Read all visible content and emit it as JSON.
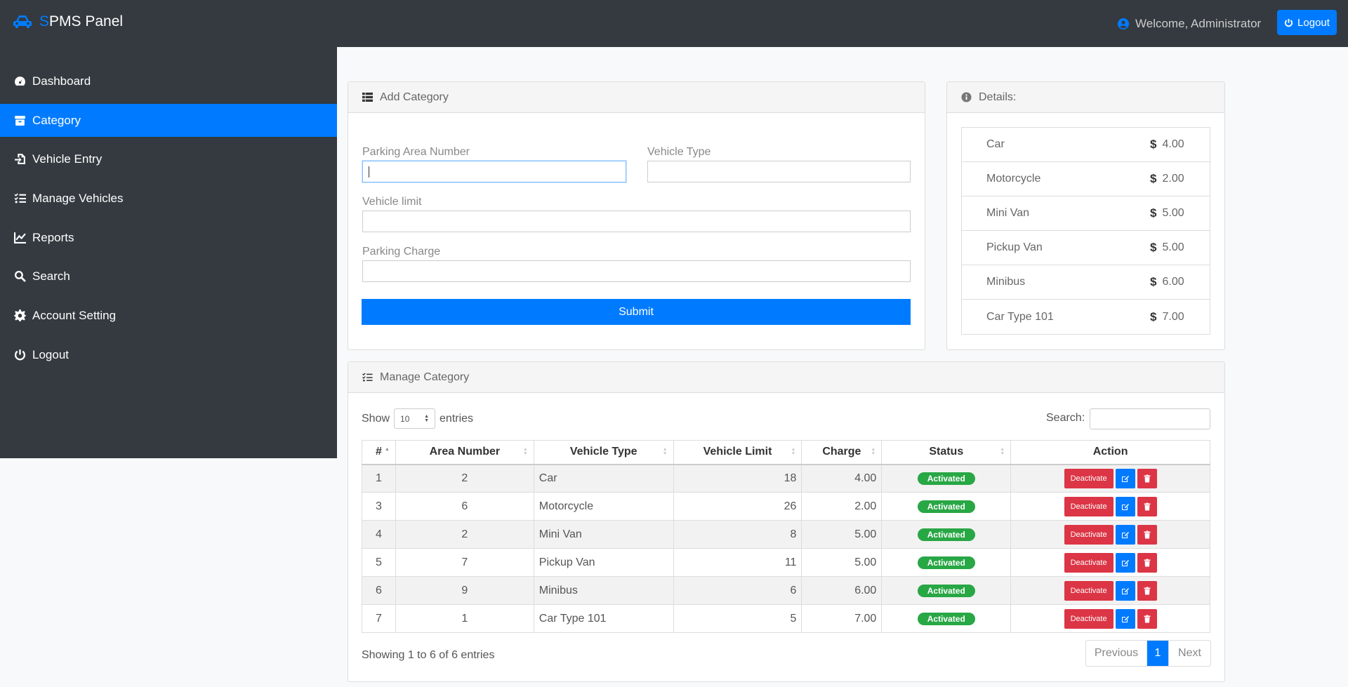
{
  "brand": {
    "first_letter": "S",
    "rest": "PMS Panel"
  },
  "header": {
    "welcome": "Welcome, Administrator",
    "logout_label": "Logout"
  },
  "sidebar": {
    "items": [
      {
        "label": "Dashboard",
        "icon": "tachometer-icon"
      },
      {
        "label": "Category",
        "icon": "box-icon",
        "active": true
      },
      {
        "label": "Vehicle Entry",
        "icon": "file-import-icon"
      },
      {
        "label": "Manage Vehicles",
        "icon": "tasks-icon"
      },
      {
        "label": "Reports",
        "icon": "line-chart-icon"
      },
      {
        "label": "Search",
        "icon": "search-icon"
      },
      {
        "label": "Account Setting",
        "icon": "gear-icon"
      },
      {
        "label": "Logout",
        "icon": "power-icon"
      }
    ]
  },
  "add_category": {
    "title": "Add Category",
    "parking_area_label": "Parking Area Number",
    "parking_area_value": "",
    "vehicle_type_label": "Vehicle Type",
    "vehicle_type_value": "",
    "vehicle_limit_label": "Vehicle limit",
    "vehicle_limit_value": "",
    "parking_charge_label": "Parking Charge",
    "parking_charge_value": "",
    "submit_label": "Submit"
  },
  "details": {
    "title": "Details:",
    "currency_symbol": "$",
    "items": [
      {
        "name": "Car",
        "price": "4.00"
      },
      {
        "name": "Motorcycle",
        "price": "2.00"
      },
      {
        "name": "Mini Van",
        "price": "5.00"
      },
      {
        "name": "Pickup Van",
        "price": "5.00"
      },
      {
        "name": "Minibus",
        "price": "6.00"
      },
      {
        "name": "Car Type 101",
        "price": "7.00"
      }
    ]
  },
  "manage_category": {
    "title": "Manage Category",
    "show_label": "Show",
    "entries_value": "10",
    "entries_label": "entries",
    "search_label": "Search:",
    "columns": [
      "#",
      "Area Number",
      "Vehicle Type",
      "Vehicle Limit",
      "Charge",
      "Status",
      "Action"
    ],
    "rows": [
      {
        "id": "1",
        "area": "2",
        "type": "Car",
        "limit": "18",
        "charge": "4.00",
        "status": "Activated",
        "action": "Deactivate"
      },
      {
        "id": "3",
        "area": "6",
        "type": "Motorcycle",
        "limit": "26",
        "charge": "2.00",
        "status": "Activated",
        "action": "Deactivate"
      },
      {
        "id": "4",
        "area": "2",
        "type": "Mini Van",
        "limit": "8",
        "charge": "5.00",
        "status": "Activated",
        "action": "Deactivate"
      },
      {
        "id": "5",
        "area": "7",
        "type": "Pickup Van",
        "limit": "11",
        "charge": "5.00",
        "status": "Activated",
        "action": "Deactivate"
      },
      {
        "id": "6",
        "area": "9",
        "type": "Minibus",
        "limit": "6",
        "charge": "6.00",
        "status": "Activated",
        "action": "Deactivate"
      },
      {
        "id": "7",
        "area": "1",
        "type": "Car Type 101",
        "limit": "5",
        "charge": "7.00",
        "status": "Activated",
        "action": "Deactivate"
      }
    ],
    "info": "Showing 1 to 6 of 6 entries",
    "pagination": {
      "previous": "Previous",
      "current": "1",
      "next": "Next"
    }
  },
  "colors": {
    "primary": "#007bff",
    "danger": "#dc3545",
    "success": "#28a745",
    "dark": "#343a40"
  }
}
